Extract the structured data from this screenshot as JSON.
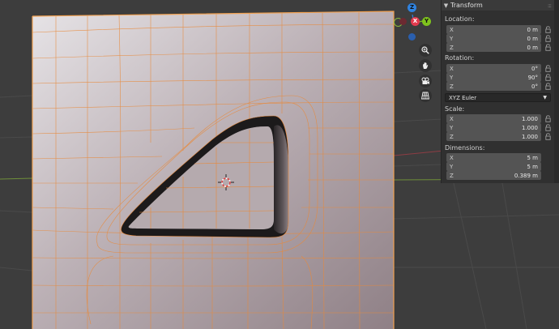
{
  "panel": {
    "title": "Transform",
    "location": {
      "label": "Location:",
      "x": {
        "axis": "X",
        "value": "0 m"
      },
      "y": {
        "axis": "Y",
        "value": "0 m"
      },
      "z": {
        "axis": "Z",
        "value": "0 m"
      }
    },
    "rotation": {
      "label": "Rotation:",
      "x": {
        "axis": "X",
        "value": "0°"
      },
      "y": {
        "axis": "Y",
        "value": "90°"
      },
      "z": {
        "axis": "Z",
        "value": "0°"
      },
      "mode": "XYZ Euler"
    },
    "scale": {
      "label": "Scale:",
      "x": {
        "axis": "X",
        "value": "1.000"
      },
      "y": {
        "axis": "Y",
        "value": "1.000"
      },
      "z": {
        "axis": "Z",
        "value": "1.000"
      }
    },
    "dimensions": {
      "label": "Dimensions:",
      "x": {
        "axis": "X",
        "value": "5 m"
      },
      "y": {
        "axis": "Y",
        "value": "5 m"
      },
      "z": {
        "axis": "Z",
        "value": "0.389 m"
      }
    }
  },
  "gizmo": {
    "z": "Z",
    "y": "Y",
    "x": "X"
  },
  "colors": {
    "edge": "#e8893a",
    "axis_x": "#e23a4e",
    "axis_y": "#7fc31d",
    "axis_z": "#2f83e0",
    "panel_bg": "#303030",
    "field_bg": "#545454"
  },
  "icons": {
    "panel_toggle": "chevron-down-icon",
    "zoom": "zoom-icon",
    "pan": "hand-icon",
    "camera": "camera-icon",
    "ortho": "grid-icon",
    "lock": "lock-icon",
    "cursor": "3d-cursor-icon"
  }
}
